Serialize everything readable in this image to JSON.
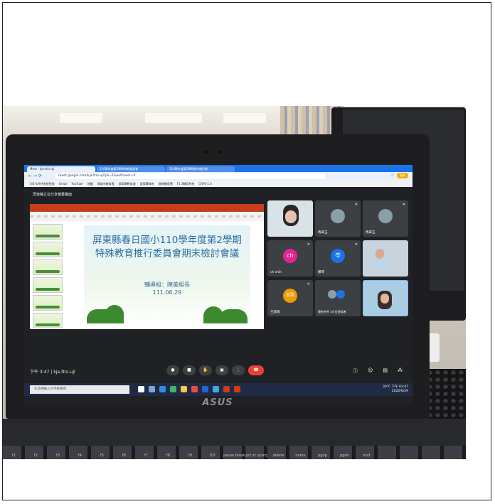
{
  "browser": {
    "tabs": [
      "Meet - kja-ttni-ujl",
      "110學年度第2學期特教委員會",
      "110學年度第2學期期末檢討會"
    ],
    "url": "meet.google.com/kja-ttni-ujl?pli=1&authuser=0",
    "update_label": "更新",
    "bookmarks": [
      "SIS-SAHA系統登錄",
      "Gmail",
      "YouTube",
      "地圖",
      "高雄市教育雲",
      "屏東縣教育處",
      "屏東縣政府",
      "國教輔導團",
      "F1.3輔導系統",
      "CRPS-1.0"
    ]
  },
  "meet": {
    "title": "屏東縣立在分享螢幕畫面",
    "clock": "下午 3:47 | kja-ttni-ujl",
    "participants": [
      {
        "name": "",
        "initial": "",
        "type": "video"
      },
      {
        "name": "馬翠玉",
        "initial": "",
        "type": "photo"
      },
      {
        "name": "馬翠玉",
        "initial": "",
        "type": "photo"
      },
      {
        "name": "ch shih",
        "initial": "ch",
        "type": "avatar",
        "color": "#e52592"
      },
      {
        "name": "鄭琴",
        "initial": "岑",
        "type": "avatar",
        "color": "#1a73e8"
      },
      {
        "name": "",
        "initial": "",
        "type": "video"
      },
      {
        "name": "王淑珮",
        "initial": "淑珮",
        "type": "avatar",
        "color": "#f29900"
      },
      {
        "name": "還有另外 14 位使用者",
        "initial": "",
        "type": "more"
      },
      {
        "name": "",
        "initial": "",
        "type": "self"
      }
    ]
  },
  "slide": {
    "title_line1": "屏東縣春日國小110學年度第2學期",
    "title_line2": "特殊教育推行委員會期末檢討會議",
    "presenter": "輔導組：陳美組長",
    "date": "111.06.29"
  },
  "taskbar": {
    "search_placeholder": "在這裡輸入文字來搜尋",
    "time": "下午 03:47",
    "date": "2022/6/29",
    "temp": "30°C"
  },
  "laptop": {
    "brand": "ASUS"
  },
  "keyboard": [
    "f1",
    "f2",
    "f3",
    "f4",
    "f5",
    "f6",
    "f7",
    "f8",
    "f9",
    "f10",
    "pause break",
    "prt sc sysrq",
    "delete",
    "home",
    "pgup",
    "pgdn",
    "end"
  ]
}
